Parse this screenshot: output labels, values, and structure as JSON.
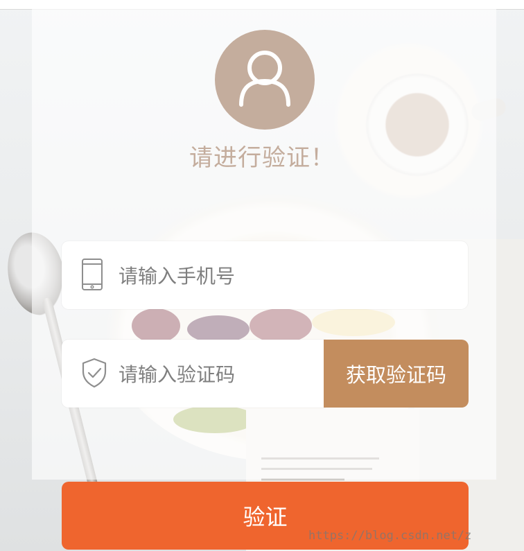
{
  "page": {
    "title": "请进行验证！"
  },
  "form": {
    "phone_placeholder": "请输入手机号",
    "code_placeholder": "请输入验证码",
    "get_code_label": "获取验证码",
    "submit_label": "验证"
  },
  "watermark": "https://blog.csdn.net/z",
  "icons": {
    "avatar": "user-icon",
    "phone": "phone-icon",
    "code": "shield-check-icon"
  },
  "colors": {
    "avatar_bg": "#c4ad9d",
    "title": "#c4ad9d",
    "get_code_bg": "#c38d5e",
    "submit_bg": "#ef652e"
  }
}
